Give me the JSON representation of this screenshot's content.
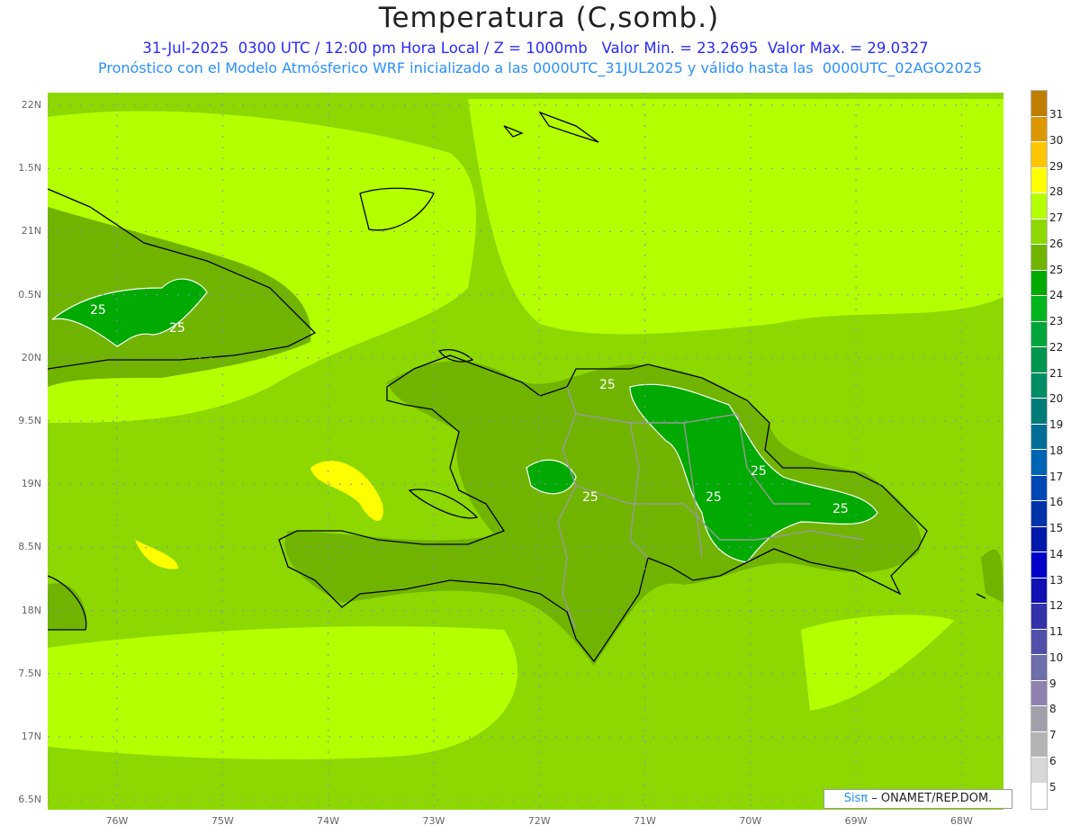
{
  "header": {
    "title": "Temperatura (C,somb.)",
    "line1": "31-Jul-2025  0300 UTC / 12:00 pm Hora Local / Z = 1000mb   Valor Min. = 23.2695  Valor Max. = 29.0327",
    "line2": "Pronóstico con el Modelo Atmósferico WRF inicializado a las 0000UTC_31JUL2025 y válido hasta las  0000UTC_02AGO2025"
  },
  "map": {
    "lat_labels": [
      "22N",
      "1.5N",
      "21N",
      "0.5N",
      "20N",
      "9.5N",
      "19N",
      "8.5N",
      "18N",
      "7.5N",
      "17N",
      "6.5N"
    ],
    "lon_labels": [
      "76W",
      "75W",
      "74W",
      "73W",
      "72W",
      "71W",
      "70W",
      "69W",
      "68W"
    ],
    "contour_labels": [
      "25",
      "25",
      "25",
      "25",
      "25",
      "25",
      "25"
    ],
    "colors": {
      "background": "#8cd800",
      "warm": "#b4ff00",
      "land": "#70b400",
      "cool": "#00aa00",
      "hot": "#ffff00"
    }
  },
  "colorbar": {
    "labels": [
      "31",
      "30",
      "29",
      "28",
      "27",
      "26",
      "25",
      "24",
      "23",
      "22",
      "21",
      "20",
      "19",
      "18",
      "17",
      "16",
      "15",
      "14",
      "13",
      "12",
      "11",
      "10",
      "9",
      "8",
      "7",
      "6",
      "5"
    ],
    "colors": [
      "#c07d00",
      "#dc9600",
      "#ffc600",
      "#ffff00",
      "#b4ff00",
      "#8cd800",
      "#70b400",
      "#00aa00",
      "#00b41e",
      "#00a53c",
      "#009650",
      "#008c64",
      "#007d78",
      "#006e96",
      "#0064b4",
      "#0046b4",
      "#0032aa",
      "#0019aa",
      "#0000c8",
      "#1010b4",
      "#3232aa",
      "#5050aa",
      "#6e6eaa",
      "#9080b0",
      "#a0a0aa",
      "#b4b4b4",
      "#d8d8d8",
      "#ffffff"
    ]
  },
  "attribution": {
    "brand": "Sisπ",
    "text": " – ONAMET/REP.DOM."
  }
}
